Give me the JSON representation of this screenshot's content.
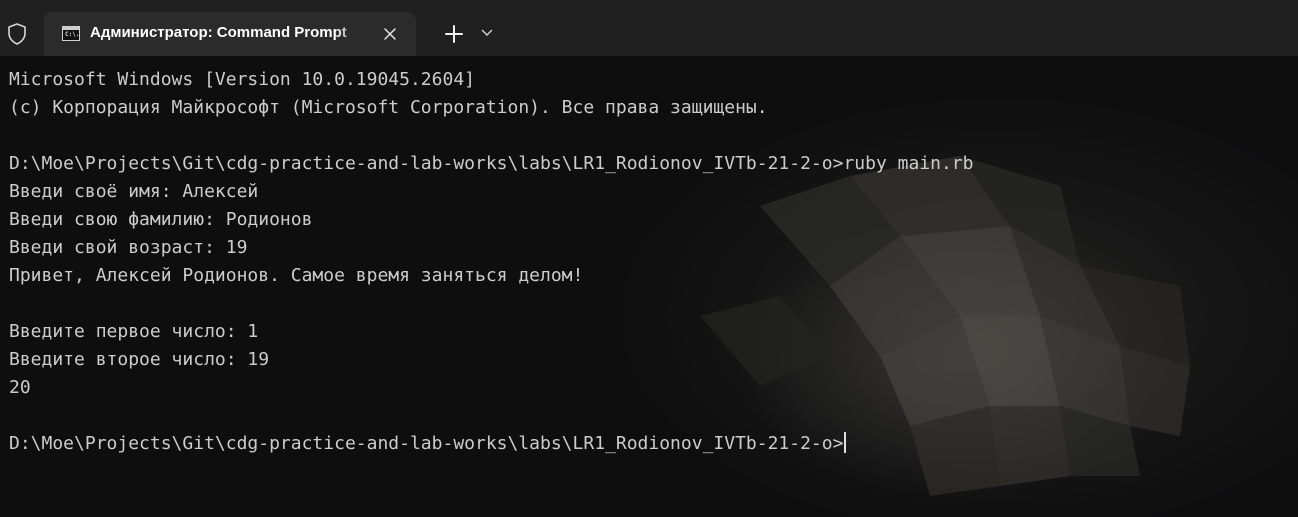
{
  "window": {
    "tab_title": "Администратор: Command Prompt",
    "tab_icon_text": "C:\\.",
    "icons": {
      "shield": "shield-icon",
      "tab": "cmd-icon",
      "close": "close-icon",
      "new_tab": "plus-icon",
      "dropdown": "chevron-down-icon"
    }
  },
  "console": {
    "lines": [
      "Microsoft Windows [Version 10.0.19045.2604]",
      "(c) Корпорация Майкрософт (Microsoft Corporation). Все права защищены.",
      "",
      "D:\\Moe\\Projects\\Git\\cdg-practice-and-lab-works\\labs\\LR1_Rodionov_IVTb-21-2-o>ruby main.rb",
      "Введи своё имя: Алексей",
      "Введи свою фамилию: Родионов",
      "Введи свой возраст: 19",
      "Привет, Алексей Родионов. Самое время заняться делом!",
      "",
      "Введите первое число: 1",
      "Введите второе число: 19",
      "20",
      "",
      "D:\\Moe\\Projects\\Git\\cdg-practice-and-lab-works\\labs\\LR1_Rodionov_IVTb-21-2-o>"
    ]
  },
  "colors": {
    "tabbar": "#202020",
    "active_tab": "#2b2b2b",
    "text": "#cccccc",
    "background": "#0e0e0f"
  }
}
